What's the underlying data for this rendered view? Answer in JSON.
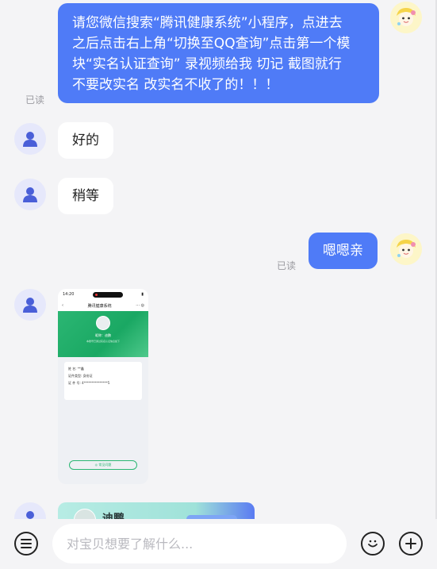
{
  "messages": [
    {
      "id": "m1",
      "direction": "out",
      "lines": [
        "请您微信搜索“腾讯健康系统”小程序，点进去",
        "之后点击右上角“切换至QQ查询”点击第一个模",
        "块“实名认证查询”  录视频给我   切记 截图就行",
        "不要改实名 改实名不收了的！！！"
      ],
      "read_status": "已读"
    },
    {
      "id": "m2",
      "direction": "in",
      "text": "好的"
    },
    {
      "id": "m3",
      "direction": "in",
      "text": "稍等"
    },
    {
      "id": "m4",
      "direction": "out",
      "text": "嗯嗯亲",
      "read_status": "已读"
    }
  ],
  "screenshot_thumb": {
    "status_time": "14:20",
    "nav_title": "腾讯健康系统",
    "profile_name": "昵称：迪鹏",
    "profile_sub": "本账号已通过实名认证信息如下",
    "rows": [
      {
        "label": "姓    名:",
        "value": "**鑫"
      },
      {
        "label": "证件类型:",
        "value": "身份证"
      },
      {
        "label": "证 件 号:",
        "value": "4***************5"
      }
    ],
    "button_label": "◎ 常见问题"
  },
  "partial_card": {
    "name": "迪鹏"
  },
  "input": {
    "placeholder": "对宝贝想要了解什么..."
  },
  "colors": {
    "accent": "#4f7bf7",
    "background": "#f4f4f6",
    "thumb_green": "#2bb673"
  }
}
